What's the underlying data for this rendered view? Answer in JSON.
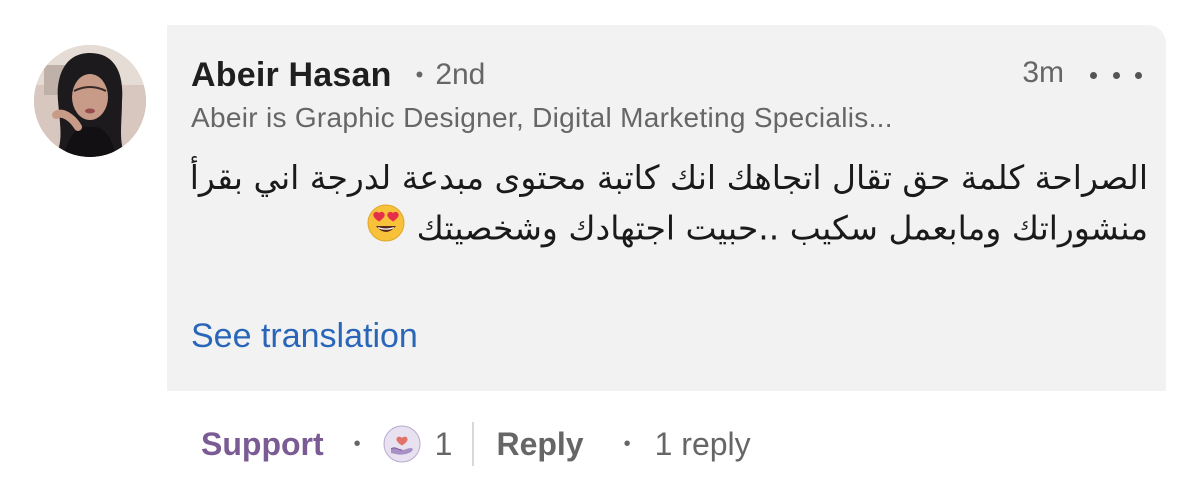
{
  "comment": {
    "author_name": "Abeir Hasan",
    "connection_degree": "2nd",
    "timestamp": "3m",
    "headline": "Abeir is Graphic Designer, Digital Marketing Specialis...",
    "body": "الصراحة كلمة حق تقال اتجاهك انك كاتبة محتوى مبدعة لدرجة اني بقرأ منشوراتك ومابعمل سكيب ..حبيت اجتهادك وشخصيتك",
    "body_emoji": "heart-eyes-emoji",
    "see_translation_label": "See translation"
  },
  "actions": {
    "support_label": "Support",
    "reaction_icon": "support-reaction-icon",
    "reaction_count": "1",
    "reply_label": "Reply",
    "replies_label": "1 reply"
  },
  "colors": {
    "bubble_background": "#f2f2f2",
    "link_blue": "#2a66b8",
    "support_purple": "#7a5b93",
    "secondary_text": "#666666"
  }
}
